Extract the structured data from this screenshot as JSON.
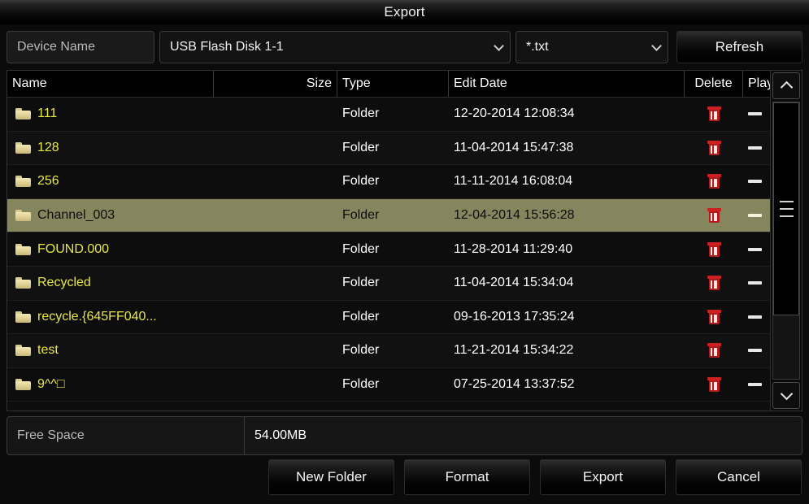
{
  "window": {
    "title": "Export"
  },
  "toolbar": {
    "device_label": "Device Name",
    "device_value": "USB Flash Disk 1-1",
    "filter_value": "*.txt",
    "refresh_label": "Refresh"
  },
  "table": {
    "columns": {
      "name": "Name",
      "size": "Size",
      "type": "Type",
      "date": "Edit Date",
      "delete": "Delete",
      "play": "Play"
    },
    "rows": [
      {
        "name": "111",
        "size": "",
        "type": "Folder",
        "date": "12-20-2014 12:08:34",
        "selected": false
      },
      {
        "name": "128",
        "size": "",
        "type": "Folder",
        "date": "11-04-2014 15:47:38",
        "selected": false
      },
      {
        "name": "256",
        "size": "",
        "type": "Folder",
        "date": "11-11-2014 16:08:04",
        "selected": false
      },
      {
        "name": "Channel_003",
        "size": "",
        "type": "Folder",
        "date": "12-04-2014 15:56:28",
        "selected": true
      },
      {
        "name": "FOUND.000",
        "size": "",
        "type": "Folder",
        "date": "11-28-2014 11:29:40",
        "selected": false
      },
      {
        "name": "Recycled",
        "size": "",
        "type": "Folder",
        "date": "11-04-2014 15:34:04",
        "selected": false
      },
      {
        "name": "recycle.{645FF040...",
        "size": "",
        "type": "Folder",
        "date": "09-16-2013 17:35:24",
        "selected": false
      },
      {
        "name": "test",
        "size": "",
        "type": "Folder",
        "date": "11-21-2014 15:34:22",
        "selected": false
      },
      {
        "name": "9^^□",
        "size": "",
        "type": "Folder",
        "date": "07-25-2014 13:37:52",
        "selected": false
      }
    ]
  },
  "free_space": {
    "label": "Free Space",
    "value": "54.00MB"
  },
  "footer": {
    "new_folder": "New Folder",
    "format": "Format",
    "export": "Export",
    "cancel": "Cancel"
  },
  "colors": {
    "name_text": "#e8e843",
    "selected_row": "#85855e",
    "delete_icon": "#b31a1a",
    "window_bg": "#0b0b0b"
  }
}
